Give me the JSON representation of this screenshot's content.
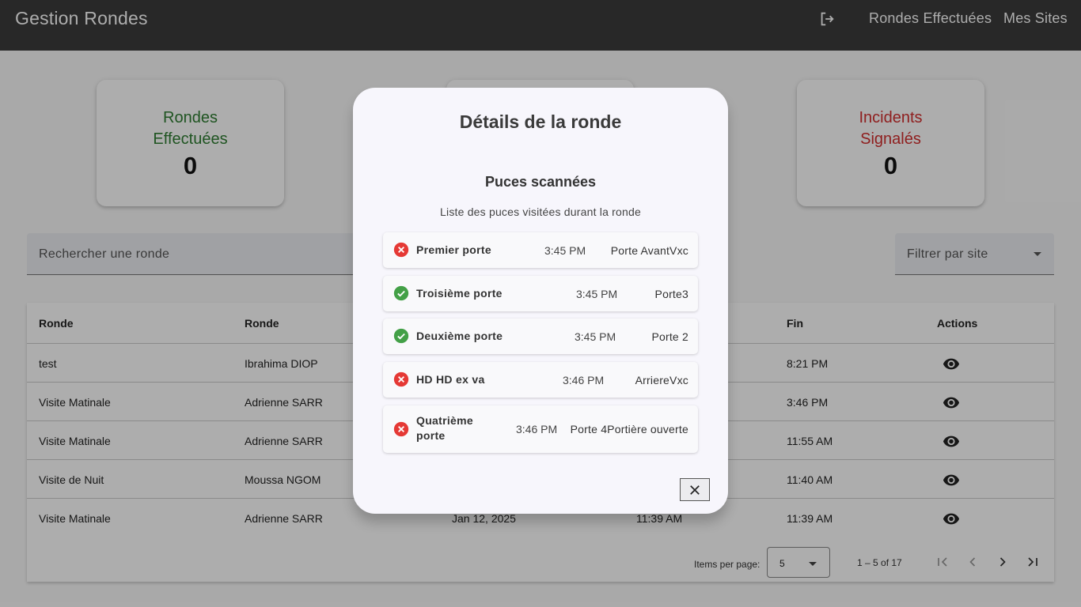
{
  "header": {
    "title": "Gestion Rondes",
    "nav": [
      "Rondes Effectuées",
      "Mes Sites"
    ],
    "logout_icon": "logout-icon"
  },
  "stats": {
    "rondes": {
      "label": "Rondes Effectuées",
      "value": "0",
      "color": "#2e7d32"
    },
    "incidents": {
      "label": "Incidents Signalés",
      "value": "0",
      "color": "#d32f2f"
    }
  },
  "search": {
    "placeholder": "Rechercher une ronde"
  },
  "filter": {
    "placeholder": "Filtrer par site"
  },
  "table": {
    "columns": [
      "Ronde",
      "Ronde",
      "",
      "",
      "Fin",
      "Actions"
    ],
    "rows": [
      {
        "ronde": "test",
        "agent": "Ibrahima DIOP",
        "date": "",
        "debut": "",
        "fin": "8:21 PM"
      },
      {
        "ronde": "Visite Matinale",
        "agent": "Adrienne SARR",
        "date": "",
        "debut": "",
        "fin": "3:46 PM"
      },
      {
        "ronde": "Visite Matinale",
        "agent": "Adrienne SARR",
        "date": "",
        "debut": "",
        "fin": "11:55 AM"
      },
      {
        "ronde": "Visite de Nuit",
        "agent": "Moussa NGOM",
        "date": "",
        "debut": "",
        "fin": "11:40 AM"
      },
      {
        "ronde": "Visite Matinale",
        "agent": "Adrienne SARR",
        "date": "Jan 12, 2025",
        "debut": "11:39 AM",
        "fin": "11:39 AM"
      }
    ]
  },
  "paginator": {
    "items_per_page_label": "Items per page:",
    "items_per_page": "5",
    "range": "1 – 5 of 17"
  },
  "dialog": {
    "title": "Détails de la ronde",
    "subtitle": "Puces scannées",
    "description": "Liste des puces visitées durant la ronde",
    "items": [
      {
        "name_lines": [
          "Premier porte"
        ],
        "time": "3:45 PM",
        "location": "Porte AvantVxc",
        "status": "error"
      },
      {
        "name_lines": [
          "Troisième porte"
        ],
        "time": "3:45 PM",
        "location": "Porte3",
        "status": "ok"
      },
      {
        "name_lines": [
          "Deuxième porte"
        ],
        "time": "3:45 PM",
        "location": "Porte 2",
        "status": "ok"
      },
      {
        "name_lines": [
          "HD HD ex va"
        ],
        "time": "3:46 PM",
        "location": "ArriereVxc",
        "status": "error"
      },
      {
        "name_lines": [
          "Quatrième",
          "porte"
        ],
        "time": "3:46 PM",
        "location": "Porte 4Portière ouverte",
        "status": "error"
      }
    ],
    "colors": {
      "ok": "#43a047",
      "error": "#e53935"
    }
  }
}
